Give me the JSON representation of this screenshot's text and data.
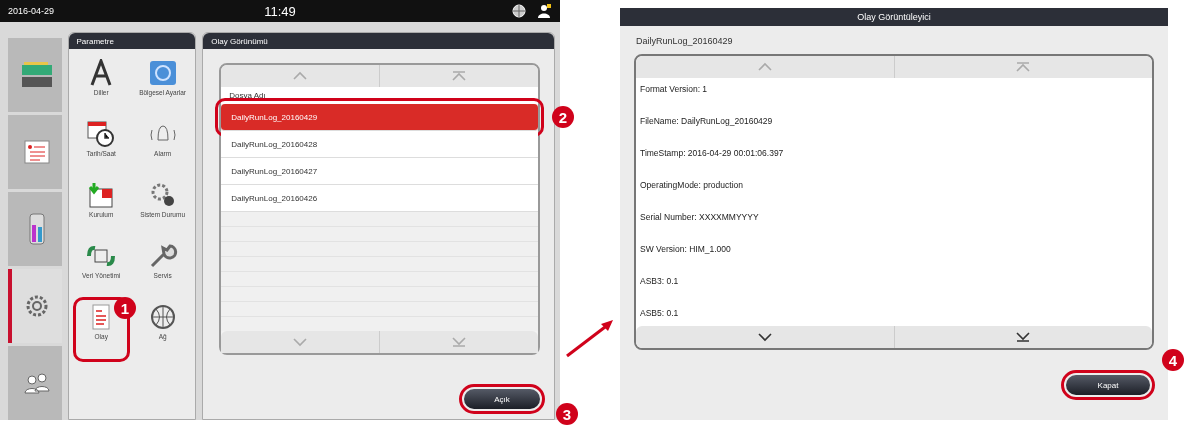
{
  "status_bar": {
    "date": "2016-04-29",
    "time": "11:49"
  },
  "side_tabs": [
    {
      "kind": "reagents",
      "selected": false
    },
    {
      "kind": "program",
      "selected": false
    },
    {
      "kind": "stations",
      "selected": false
    },
    {
      "kind": "settings",
      "selected": true
    },
    {
      "kind": "users",
      "selected": false
    }
  ],
  "parameter_panel": {
    "title": "Parametre",
    "items": [
      {
        "kind": "language",
        "label": "Diller",
        "highlighted": false
      },
      {
        "kind": "region",
        "label": "Bölgesel Ayarlar",
        "highlighted": false
      },
      {
        "kind": "datetime",
        "label": "Tarih/Saat",
        "highlighted": false
      },
      {
        "kind": "alarm",
        "label": "Alarm",
        "highlighted": false
      },
      {
        "kind": "setup",
        "label": "Kurulum",
        "highlighted": false
      },
      {
        "kind": "system",
        "label": "Sistem Durumu",
        "highlighted": false
      },
      {
        "kind": "data",
        "label": "Veri Yönetimi",
        "highlighted": false
      },
      {
        "kind": "service",
        "label": "Servis",
        "highlighted": false
      },
      {
        "kind": "event",
        "label": "Olay",
        "highlighted": true,
        "callout": "1"
      },
      {
        "kind": "network",
        "label": "Ağ",
        "highlighted": false
      }
    ]
  },
  "event_panel": {
    "title": "Olay Görünümü",
    "column": "Dosya Adı",
    "rows": [
      {
        "name": "DailyRunLog_20160429",
        "selected": true,
        "callout": "2"
      },
      {
        "name": "DailyRunLog_20160428",
        "selected": false
      },
      {
        "name": "DailyRunLog_20160427",
        "selected": false
      },
      {
        "name": "DailyRunLog_20160426",
        "selected": false
      }
    ],
    "open_button": {
      "label": "Açık",
      "callout": "3"
    }
  },
  "viewer_dialog": {
    "title": "Olay Görüntüleyici",
    "file_name": "DailyRunLog_20160429",
    "lines": [
      {
        "text": "Format Version: 1"
      },
      {
        "text": "FileName: DailyRunLog_20160429"
      },
      {
        "text": "TimeStamp: 2016-04-29 00:01:06.397"
      },
      {
        "text": "OperatingMode: production"
      },
      {
        "text": "Serial Number: XXXXMMYYYY"
      },
      {
        "text": "SW Version: HIM_1.000"
      },
      {
        "text": "ASB3: 0.1"
      },
      {
        "text": "ASB5: 0.1"
      }
    ],
    "close_button": {
      "label": "Kapat",
      "callout": "4"
    }
  }
}
